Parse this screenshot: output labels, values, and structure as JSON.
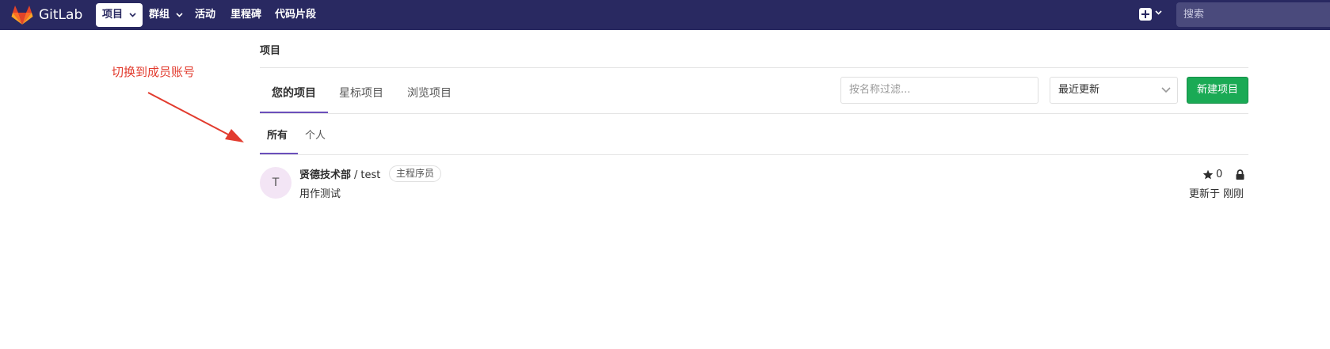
{
  "navbar": {
    "brand": "GitLab",
    "items": [
      {
        "label": "项目",
        "active": true,
        "dropdown": true
      },
      {
        "label": "群组",
        "active": false,
        "dropdown": true
      },
      {
        "label": "活动",
        "active": false,
        "dropdown": false
      },
      {
        "label": "里程碑",
        "active": false,
        "dropdown": false
      },
      {
        "label": "代码片段",
        "active": false,
        "dropdown": false
      }
    ],
    "search_placeholder": "搜索",
    "icons": [
      "gitlab-logo",
      "plus-square-icon",
      "chevron-down-icon"
    ]
  },
  "annotation": {
    "text": "切换到成员账号",
    "color": "#e23b2e"
  },
  "breadcrumb": "项目",
  "tabs": [
    {
      "label": "您的项目",
      "active": true
    },
    {
      "label": "星标项目",
      "active": false
    },
    {
      "label": "浏览项目",
      "active": false
    }
  ],
  "filter_placeholder": "按名称过滤...",
  "sort_selected": "最近更新",
  "new_project_label": "新建项目",
  "subtabs": [
    {
      "label": "所有",
      "active": true
    },
    {
      "label": "个人",
      "active": false
    }
  ],
  "projects": [
    {
      "avatar_letter": "T",
      "namespace": "贤德技术部",
      "separator": "/",
      "name": "test",
      "role": "主程序员",
      "description": "用作测试",
      "stars": "0",
      "updated": "更新于 刚刚"
    }
  ],
  "colors": {
    "navbar_bg": "#292961",
    "accent": "#6b4fbb",
    "new_button": "#1aaa55",
    "avatar_bg": "#f3e5f5"
  }
}
